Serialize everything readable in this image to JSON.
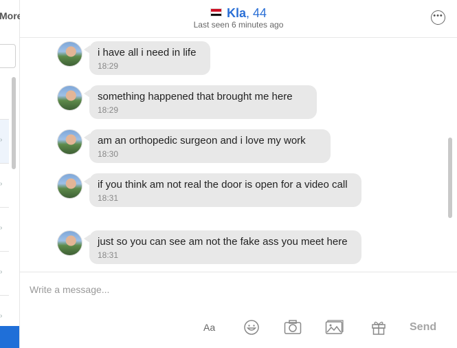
{
  "sidebar": {
    "more_label": "More"
  },
  "header": {
    "contact_name": "Kla",
    "contact_age": ", 44",
    "last_seen": "Last seen 6 minutes ago"
  },
  "messages": [
    {
      "text": "i have all i need in life",
      "time": "18:29"
    },
    {
      "text": "something happened that brought me here",
      "time": "18:29"
    },
    {
      "text": "am an orthopedic surgeon and i love my work",
      "time": "18:30"
    },
    {
      "text": "if you think am not real the door is open for a video call",
      "time": "18:31"
    },
    {
      "text": "just so you can see am not the fake ass you meet here",
      "time": "18:31"
    }
  ],
  "composer": {
    "placeholder": "Write a message...",
    "format_label": "Aa",
    "send_label": "Send"
  },
  "icons": {
    "flag": "egypt-flag",
    "more_options": "ellipsis-circle-icon",
    "emoji": "smiley-icon",
    "camera": "camera-icon",
    "photo": "image-icon",
    "gift": "gift-icon"
  },
  "colors": {
    "accent": "#2a6fd6",
    "bubble": "#e8e8e8",
    "sidebar_active": "#1f6fd8"
  }
}
